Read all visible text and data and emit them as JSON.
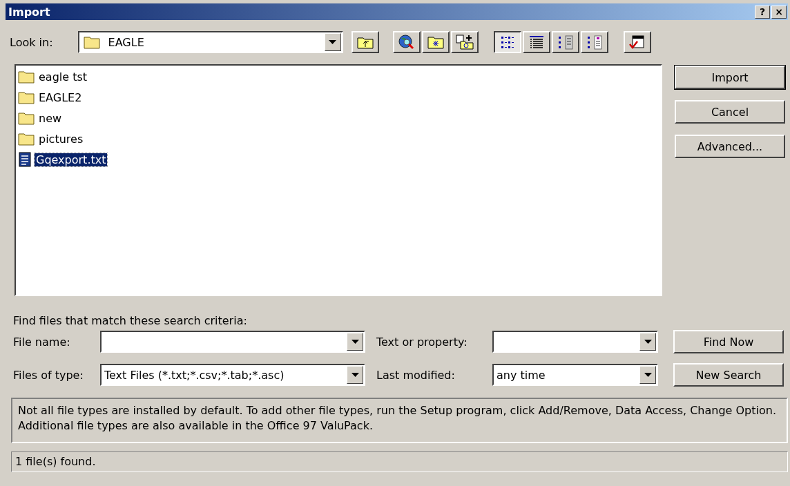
{
  "window": {
    "title": "Import",
    "title_buttons": [
      "?",
      "×"
    ]
  },
  "look_in": {
    "label": "Look in:",
    "value": "EAGLE"
  },
  "toolbar": [
    {
      "kind": "up-folder"
    },
    {
      "kind": "web"
    },
    {
      "kind": "favorites"
    },
    {
      "kind": "add-favorite"
    },
    {
      "kind": "list-view",
      "selected": true
    },
    {
      "kind": "details-view",
      "selected": false
    },
    {
      "kind": "properties-view",
      "selected": false
    },
    {
      "kind": "preview-view",
      "selected": false
    },
    {
      "kind": "commands"
    }
  ],
  "files": [
    {
      "name": "eagle tst",
      "kind": "folder",
      "selected": false
    },
    {
      "name": "EAGLE2",
      "kind": "folder",
      "selected": false
    },
    {
      "name": "new",
      "kind": "folder",
      "selected": false
    },
    {
      "name": "pictures",
      "kind": "folder",
      "selected": false
    },
    {
      "name": "Gqexport.txt",
      "kind": "file",
      "selected": true
    }
  ],
  "buttons": [
    "Import",
    "Cancel",
    "Advanced..."
  ],
  "criteria": {
    "heading": "Find files that match these search criteria:",
    "fields": [
      {
        "label": "File name:"
      },
      {
        "label": "Text or property:"
      },
      {
        "label": "Files of type:",
        "value": "Text Files (*.txt;*.csv;*.tab;*.asc)"
      },
      {
        "label": "Last modified:",
        "value": "any time"
      }
    ],
    "buttons": [
      "Find Now",
      "New Search"
    ]
  },
  "note": "Not all file types are installed by default.  To add other file types, run the Setup program, click Add/Remove, Data Access, Change Option.  Additional file types are also available in the Office 97 ValuPack.",
  "status_bar": "1 file(s) found."
}
